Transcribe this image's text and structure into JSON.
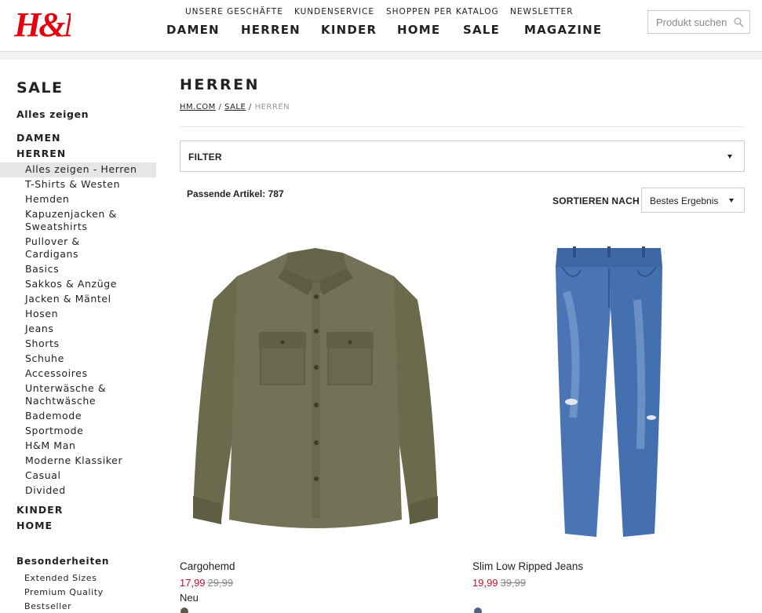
{
  "brand": {
    "logo_text": "H&M",
    "color": "#e50010"
  },
  "header": {
    "top_links": [
      "UNSERE GESCHÄFTE",
      "KUNDENSERVICE",
      "SHOPPEN PER KATALOG",
      "NEWSLETTER"
    ],
    "main_nav": [
      "DAMEN",
      "HERREN",
      "KINDER",
      "HOME",
      "SALE",
      "MAGAZINE"
    ],
    "search": {
      "placeholder": "Produkt suchen",
      "icon": "search-icon"
    }
  },
  "sidebar": {
    "title": "SALE",
    "show_all": "Alles zeigen",
    "categories": {
      "damen": "DAMEN",
      "herren": "HERREN",
      "kinder": "KINDER",
      "home": "HOME"
    },
    "herren_items": [
      "Alles zeigen - Herren",
      "T-Shirts & Westen",
      "Hemden",
      "Kapuzenjacken &",
      "Sweatshirts",
      "Pullover &",
      "Cardigans",
      "Basics",
      "Sakkos & Anzüge",
      "Jacken & Mäntel",
      "Hosen",
      "Jeans",
      "Shorts",
      "Schuhe",
      "Accessoires",
      "Unterwäsche &",
      "Nachtwäsche",
      "Bademode",
      "Sportmode",
      "H&M Man",
      "Moderne Klassiker",
      "Casual",
      "Divided"
    ],
    "active_item": "Alles zeigen - Herren",
    "specials_title": "Besonderheiten",
    "specials": [
      "Extended Sizes",
      "Premium Quality",
      "Bestseller"
    ]
  },
  "main": {
    "title": "HERREN",
    "breadcrumb": {
      "home": "HM.COM",
      "sep1": "/",
      "sale": "SALE",
      "sep2": "/",
      "current": "HERREN"
    },
    "filter_label": "FILTER",
    "count_text": "Passende Artikel: 787",
    "sort_label": "SORTIEREN NACH",
    "sort_value": "Bestes Ergebnis"
  },
  "products": [
    {
      "name": "Cargohemd",
      "price": "17,99",
      "old_price": "29,99",
      "badge": "Neu",
      "swatch_color": "#5d5a48",
      "image": "olive-shirt"
    },
    {
      "name": "Slim Low Ripped Jeans",
      "price": "19,99",
      "old_price": "39,99",
      "badge": "",
      "swatch_color": "#4b6386",
      "image": "blue-jeans"
    }
  ],
  "colors": {
    "sale_price": "#c8102e",
    "shirt": "#6e6b4e",
    "denim": "#4a72b0"
  }
}
